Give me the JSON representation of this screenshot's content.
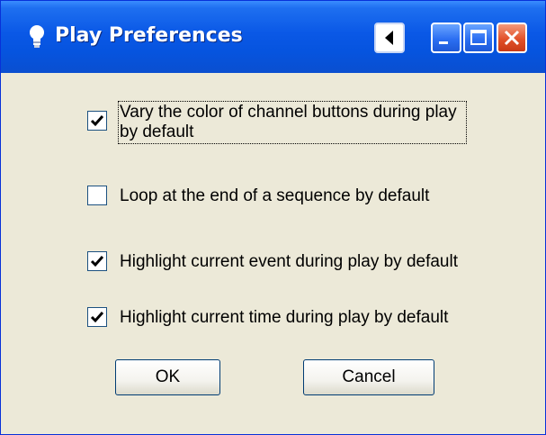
{
  "window": {
    "title": "Play Preferences",
    "icon": "lightbulb-icon"
  },
  "titlebar_buttons": {
    "back_icon": "back-arrow-icon",
    "minimize_icon": "minimize-icon",
    "maximize_icon": "maximize-icon",
    "close_icon": "close-icon"
  },
  "options": [
    {
      "label": "Vary the color of channel buttons during play by default",
      "checked": true
    },
    {
      "label": "Loop at the end of a sequence by default",
      "checked": false
    },
    {
      "label": "Highlight current event during play by default",
      "checked": true
    },
    {
      "label": "Highlight current time during play by default",
      "checked": true
    }
  ],
  "buttons": {
    "ok_label": "OK",
    "cancel_label": "Cancel"
  },
  "colors": {
    "titlebar": "#0a58e6",
    "dialog_bg": "#ece9d8",
    "close_button": "#e2512a"
  }
}
